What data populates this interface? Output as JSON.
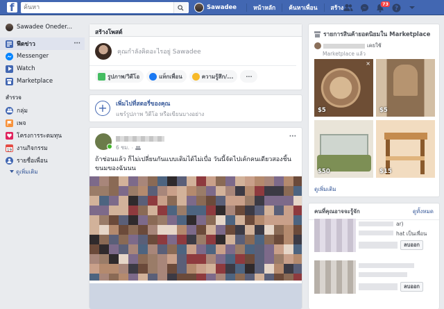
{
  "topbar": {
    "logo": "f",
    "search_placeholder": "ค้นหา",
    "user_name": "Sawadee",
    "nav": [
      "หน้าหลัก",
      "ค้นหาเพื่อน",
      "สร้าง"
    ],
    "notification_count": "73"
  },
  "sidebar": {
    "profile_name": "Sawadee Oneder...",
    "main_items": [
      {
        "label": "ฟีดข่าว",
        "icon": "news-feed-icon",
        "color": "#4267b2"
      },
      {
        "label": "Messenger",
        "icon": "messenger-icon",
        "color": "#0084ff"
      },
      {
        "label": "Watch",
        "icon": "watch-icon",
        "color": "#4267b2"
      },
      {
        "label": "Marketplace",
        "icon": "marketplace-icon",
        "color": "#4267b2"
      }
    ],
    "explore_title": "สำรวจ",
    "explore_items": [
      {
        "label": "กลุ่ม",
        "icon": "groups-icon",
        "color": "#4267b2"
      },
      {
        "label": "เพจ",
        "icon": "pages-icon",
        "color": "#f7923b"
      },
      {
        "label": "โครงการระดมทุน",
        "icon": "fundraiser-icon",
        "color": "#e0245e"
      },
      {
        "label": "งานกิจกรรม",
        "icon": "events-icon",
        "color": "#e44b43"
      },
      {
        "label": "รายชื่อเพื่อน",
        "icon": "friend-lists-icon",
        "color": "#4267b2"
      }
    ],
    "see_more": "ดูเพิ่มเติม"
  },
  "composer": {
    "title": "สร้างโพสต์",
    "placeholder": "คุณกำลังคิดอะไรอยู่ Sawadee",
    "actions": [
      {
        "label": "รูปภาพ/วิดีโอ",
        "icon": "photo-video-icon",
        "color": "#45bd62"
      },
      {
        "label": "แท็กเพื่อน",
        "icon": "tag-friends-icon",
        "color": "#1877f2"
      },
      {
        "label": "ความรู้สึก/...",
        "icon": "feeling-icon",
        "color": "#f7b928"
      }
    ],
    "more": "···"
  },
  "story": {
    "title": "เพิ่มไปที่สตอรี่ของคุณ",
    "subtitle": "แชร์รูปภาพ วิดีโอ หรือเขียนบางอย่าง"
  },
  "post": {
    "time": "6 ชม.",
    "text": "ถ้าช่อนแล้ว ก็ไม่เปลี่ยนกันแบบเดิมได้ไม่เบื่อ วันนี้จัดไปเค้กคนเดียวสองชิ้น ขนมของฉันนน",
    "more": "···"
  },
  "marketplace": {
    "title": "รายการสินค้ายอดนิยมใน Marketplace",
    "subline": "เคยใช้",
    "subline2": "Marketplace แล้ว",
    "items": [
      {
        "price": "$5",
        "palette": [
          "#a07a5a",
          "#d7b892",
          "#6e4e35",
          "#c8a47d"
        ]
      },
      {
        "price": "$5",
        "palette": [
          "#8c6f52",
          "#b69470",
          "#5e4633",
          "#d3bfa5"
        ]
      },
      {
        "price": "$50",
        "palette": [
          "#7d8f55",
          "#cfd6cf",
          "#5a6a3a",
          "#e9e4d8"
        ]
      },
      {
        "price": "$15",
        "palette": [
          "#c48b4e",
          "#e0b47d",
          "#8a5a2c",
          "#f2dcc0"
        ]
      }
    ],
    "see_more": "ดูเพิ่มเติม"
  },
  "pymk": {
    "title": "คนที่คุณอาจจะรู้จัก",
    "see_all": "ดูทั้งหมด",
    "people": [
      {
        "line1": "ar)",
        "line2": "hat เป็นเพื่อน",
        "button": "ลบออก"
      },
      {
        "line1": "",
        "line2": "",
        "button": "ลบออก"
      }
    ]
  }
}
